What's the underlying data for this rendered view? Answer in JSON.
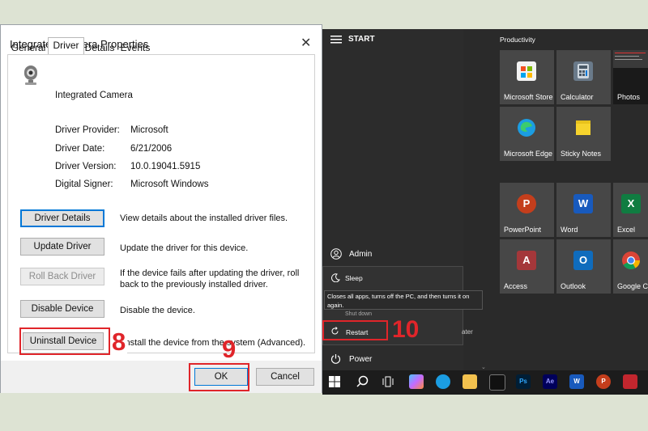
{
  "dialog": {
    "title": "Integrated Camera Properties",
    "close": "✕",
    "tabs": [
      "General",
      "Driver",
      "Details",
      "Events"
    ],
    "device_name": "Integrated Camera",
    "info": [
      {
        "label": "Driver Provider:",
        "value": "Microsoft"
      },
      {
        "label": "Driver Date:",
        "value": "6/21/2006"
      },
      {
        "label": "Driver Version:",
        "value": "10.0.19041.5915"
      },
      {
        "label": "Digital Signer:",
        "value": "Microsoft Windows"
      }
    ],
    "actions": [
      {
        "button": "Driver Details",
        "desc": "View details about the installed driver files."
      },
      {
        "button": "Update Driver",
        "desc": "Update the driver for this device."
      },
      {
        "button": "Roll Back Driver",
        "desc1": "If the device fails after updating the driver, roll",
        "desc2": "back to the previously installed driver."
      },
      {
        "button": "Disable Device",
        "desc": "Disable the device."
      },
      {
        "button": "Uninstall Device",
        "desc": "Uninstall the device from the system (Advanced)."
      }
    ],
    "ok": "OK",
    "cancel": "Cancel"
  },
  "annotations": {
    "step8": "8",
    "step9": "9",
    "step10": "10"
  },
  "start": {
    "header": "START",
    "group_label": "Productivity",
    "user": "Admin",
    "power_menu": {
      "sleep": "Sleep",
      "tooltip": "Closes all apps, turns off the PC, and then turns it on again.",
      "shutdown_partial": "Shut down",
      "restart": "Restart",
      "update_partial": "ater"
    },
    "power": "Power",
    "tiles": [
      {
        "label": "Microsoft Store",
        "icon": "MS",
        "color": "#0f78d4"
      },
      {
        "label": "Calculator",
        "icon": "▦",
        "color": "#5b6b7b"
      },
      {
        "label": "Photos",
        "icon": "",
        "color": "#222222"
      },
      {
        "label": "Microsoft Edge",
        "icon": "e",
        "color": "#1b9de2"
      },
      {
        "label": "Sticky Notes",
        "icon": "▪",
        "color": "#f6d32d"
      },
      {
        "label": "PowerPoint",
        "icon": "P",
        "color": "#c43e1c"
      },
      {
        "label": "Word",
        "icon": "W",
        "color": "#185abd"
      },
      {
        "label": "Excel",
        "icon": "X",
        "color": "#107c41"
      },
      {
        "label": "Access",
        "icon": "A",
        "color": "#a4373a"
      },
      {
        "label": "Outlook",
        "icon": "O",
        "color": "#0f6cbd"
      },
      {
        "label": "Google Ch",
        "icon": "◉",
        "color": "#4285f4"
      }
    ],
    "taskbar": [
      "windows-start-icon",
      "search-icon",
      "task-view-icon",
      "copilot-icon",
      "edge-icon",
      "file-explorer-icon",
      "terminal-icon",
      "photoshop-icon",
      "after-effects-icon",
      "word-icon",
      "powerpoint-icon",
      "hp-icon"
    ],
    "taskbar_labels": [
      "",
      "",
      "",
      "",
      "",
      "",
      "",
      "Ps",
      "Ae",
      "W",
      "P",
      ""
    ]
  }
}
